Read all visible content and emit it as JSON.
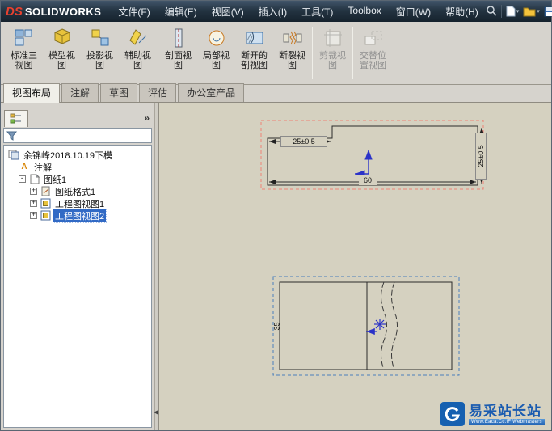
{
  "app": {
    "logo_ds": "DS",
    "logo_name": "SOLIDWORKS"
  },
  "menubar": {
    "items": [
      "文件(F)",
      "编辑(E)",
      "视图(V)",
      "插入(I)",
      "工具(T)",
      "Toolbox",
      "窗口(W)",
      "帮助(H)"
    ]
  },
  "ribbon": {
    "buttons": [
      {
        "label": "标准三视图"
      },
      {
        "label": "模型视图"
      },
      {
        "label": "投影视图"
      },
      {
        "label": "辅助视图"
      },
      {
        "label": "剖面视图"
      },
      {
        "label": "局部视图"
      },
      {
        "label": "断开的剖视图"
      },
      {
        "label": "断裂视图"
      },
      {
        "label": "剪裁视图"
      },
      {
        "label": "交替位置视图"
      }
    ]
  },
  "tabs": {
    "items": [
      {
        "label": "视图布局"
      },
      {
        "label": "注解"
      },
      {
        "label": "草图"
      },
      {
        "label": "评估"
      },
      {
        "label": "办公室产品"
      }
    ]
  },
  "panel": {
    "chevron": "»",
    "tree": {
      "root": "余锦峰2018.10.19下模",
      "items": [
        {
          "label": "注解",
          "box": ""
        },
        {
          "label": "图纸1",
          "box": "-"
        },
        {
          "label": "图纸格式1",
          "box": "+"
        },
        {
          "label": "工程图视图1",
          "box": "+"
        },
        {
          "label": "工程图视图2",
          "box": "+",
          "selected": true
        }
      ]
    }
  },
  "drawing": {
    "view1": {
      "dim_top": "25±0.5",
      "dim_right": "25±0.5",
      "dim_bottom": "60"
    },
    "view2": {
      "dim_left": "35"
    }
  },
  "watermark": {
    "title": "易采站长站",
    "subtitle": "Www.Eaca.Cc.iF Webmasters"
  }
}
